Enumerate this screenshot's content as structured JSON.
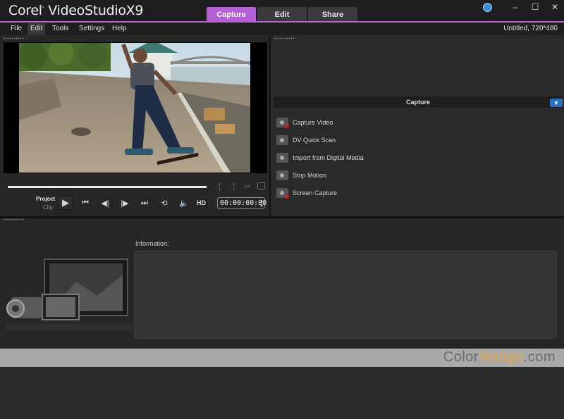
{
  "app": {
    "brand": "Corel",
    "product": "VideoStudioX9"
  },
  "tabs": [
    {
      "label": "Capture",
      "active": true
    },
    {
      "label": "Edit",
      "active": false
    },
    {
      "label": "Share",
      "active": false
    }
  ],
  "window_controls": {
    "minimize": "–",
    "maximize": "☐",
    "close": "✕"
  },
  "menu": [
    {
      "label": "File"
    },
    {
      "label": "Edit"
    },
    {
      "label": "Tools"
    },
    {
      "label": "Settings"
    },
    {
      "label": "Help"
    }
  ],
  "project_info": "Untitled, 720*480",
  "player": {
    "mark_in": "[",
    "mark_out": "]",
    "project_label": "Project",
    "clip_label": "Clip",
    "hd_label": "HD",
    "timecode": "00:00:00:00"
  },
  "capture": {
    "header": "Capture",
    "items": [
      {
        "label": "Capture Video",
        "icon": "camcorder-icon"
      },
      {
        "label": "DV Quick Scan",
        "icon": "dv-scan-icon"
      },
      {
        "label": "Import from Digital Media",
        "icon": "disc-import-icon"
      },
      {
        "label": "Stop Motion",
        "icon": "stop-motion-icon"
      },
      {
        "label": "Screen Capture",
        "icon": "screen-capture-icon"
      }
    ]
  },
  "information": {
    "label": "Information:"
  },
  "watermark": {
    "part1": "Color",
    "part2": "Mango",
    "part3": ".com"
  },
  "colors": {
    "accent": "#b45fd6",
    "dropdown": "#2d6fbf"
  }
}
